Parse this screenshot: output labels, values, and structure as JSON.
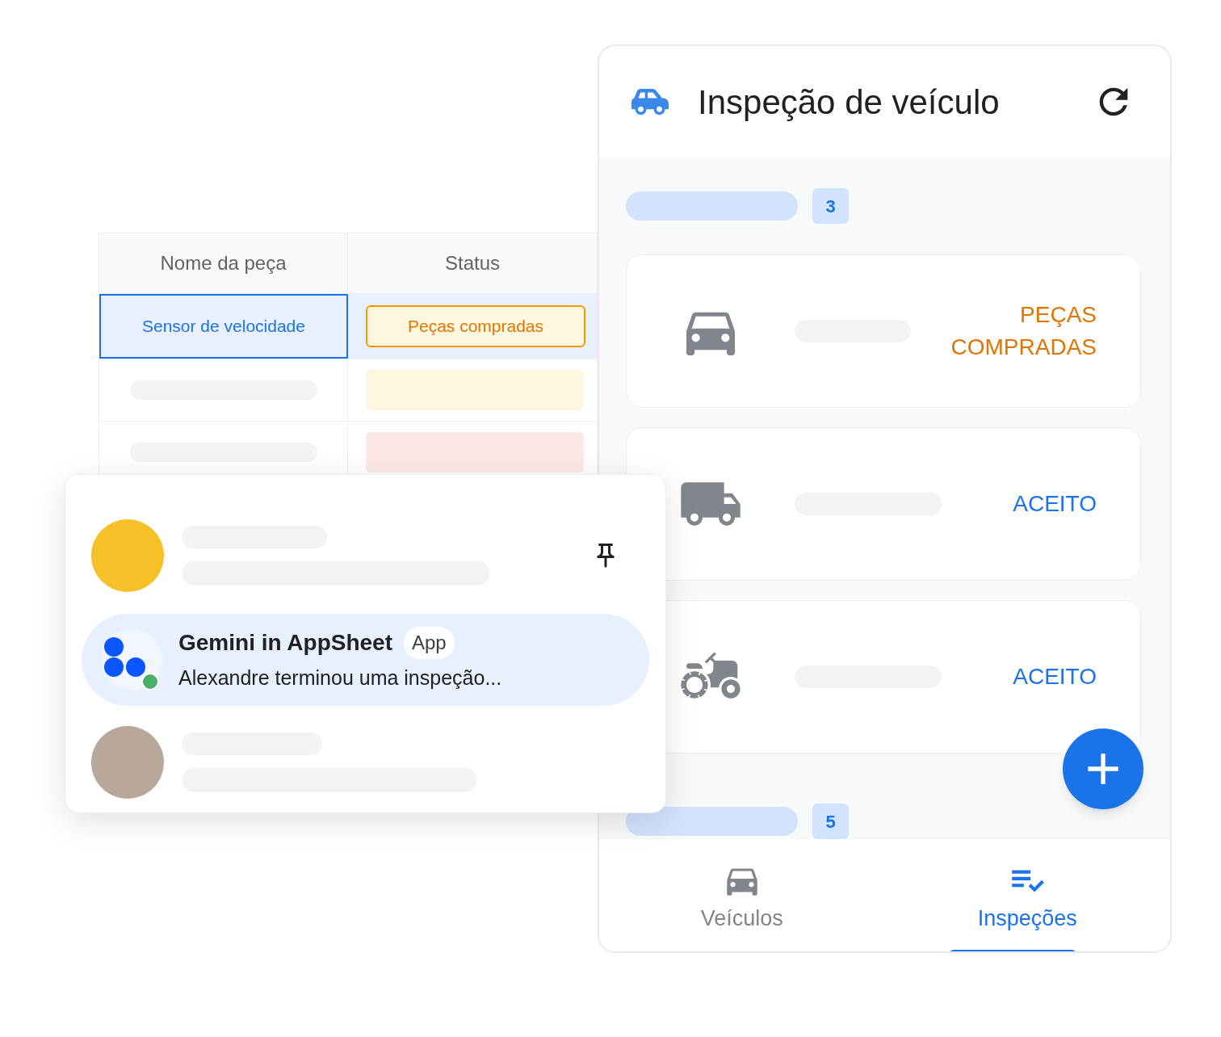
{
  "table": {
    "columns": [
      "Nome da peça",
      "Status"
    ],
    "rows": [
      {
        "part": "Sensor de velocidade",
        "status": "Peças compradas",
        "selected": true
      }
    ],
    "placeholder_rows": [
      {
        "color": "#fdf6e1"
      },
      {
        "color": "#fce8e6"
      }
    ]
  },
  "phone": {
    "title": "Inspeção de veículo",
    "groups": [
      {
        "count": "3",
        "cards": [
          {
            "kind": "car",
            "status": "PEÇAS COMPRADAS",
            "color": "#e37400"
          },
          {
            "kind": "truck",
            "status": "ACEITO",
            "color": "#1a73e8"
          },
          {
            "kind": "tractor",
            "status": "ACEITO",
            "color": "#1a73e8"
          }
        ]
      },
      {
        "count": "5"
      }
    ],
    "nav": [
      {
        "kind": "car",
        "label": "Veículos",
        "selected": false
      },
      {
        "kind": "checklist",
        "label": "Inspeções",
        "selected": true
      }
    ]
  },
  "notifications": [
    {
      "kind": "placeholder",
      "pinned": true,
      "selected": false
    },
    {
      "kind": "message",
      "title": "Gemini in AppSheet",
      "badge": "App",
      "text": "Alexandre terminou uma inspeção...",
      "selected": true
    },
    {
      "kind": "placeholder",
      "pinned": false,
      "selected": false
    }
  ]
}
